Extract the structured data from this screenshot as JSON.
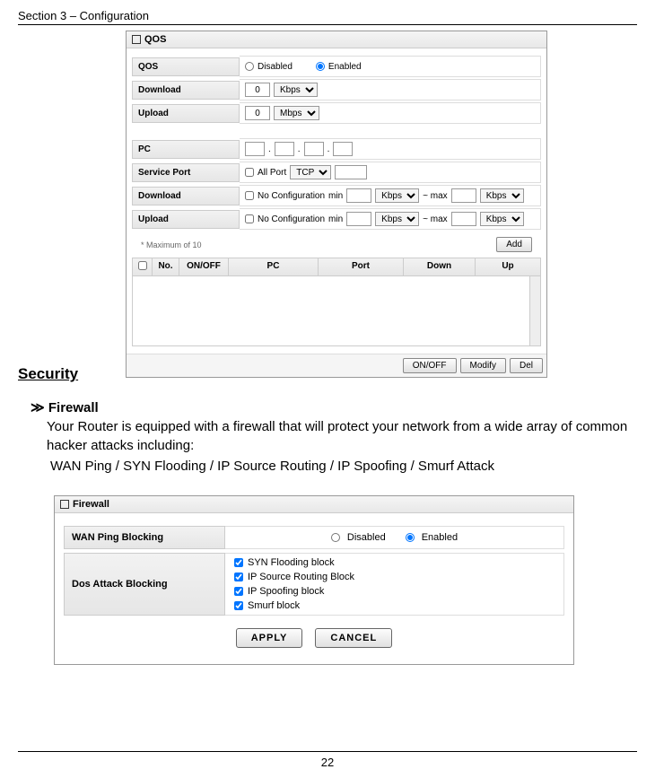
{
  "header": "Section 3 – Configuration",
  "page_number": "22",
  "qos": {
    "title": "QOS",
    "rows": {
      "qos_label": "QOS",
      "qos_disabled": "Disabled",
      "qos_enabled": "Enabled",
      "download_label": "Download",
      "download_value": "0",
      "download_unit": "Kbps",
      "upload_label": "Upload",
      "upload_value": "0",
      "upload_unit": "Mbps",
      "pc_label": "PC",
      "service_port_label": "Service Port",
      "all_port": "All Port",
      "tcp": "TCP",
      "download2_label": "Download",
      "noconfig": "No Configuration",
      "min": "min",
      "max": "~ max",
      "kbps": "Kbps",
      "upload2_label": "Upload"
    },
    "maxof": "* Maximum of 10",
    "add": "Add",
    "cols": {
      "no": "No.",
      "onoff": "ON/OFF",
      "pc": "PC",
      "port": "Port",
      "down": "Down",
      "up": "Up"
    },
    "buttons": {
      "onoff": "ON/OFF",
      "modify": "Modify",
      "del": "Del"
    }
  },
  "security_heading": "Security",
  "firewall_heading": "≫ Firewall",
  "firewall_text1": "Your Router is equipped with a firewall that will protect your network from a wide array of common hacker attacks including:",
  "firewall_text2": "WAN Ping / SYN Flooding / IP Source Routing / IP Spoofing / Smurf Attack",
  "fw_panel": {
    "title": "Firewall",
    "wan_label": "WAN Ping Blocking",
    "disabled": "Disabled",
    "enabled": "Enabled",
    "dos_label": "Dos Attack Blocking",
    "opts": {
      "syn": "SYN Flooding block",
      "iproute": "IP Source Routing Block",
      "ipspoof": "IP Spoofing block",
      "smurf": "Smurf block"
    },
    "apply": "APPLY",
    "cancel": "CANCEL"
  }
}
